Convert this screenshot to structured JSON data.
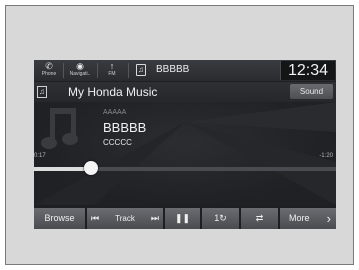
{
  "statusbar": {
    "phone": {
      "icon": "phone-icon",
      "label": "Phone"
    },
    "navigation": {
      "icon": "navigation-icon",
      "label": "Navigati.."
    },
    "fm": {
      "icon": "radio-icon",
      "label": "FM"
    },
    "source_icon": "music-note-icon",
    "source_name": "BBBBB",
    "clock": "12:34"
  },
  "header": {
    "icon": "music-note-icon",
    "title": "My Honda Music",
    "sound_label": "Sound"
  },
  "now_playing": {
    "album": "AAAAA",
    "track": "BBBBB",
    "artist": "CCCCC",
    "elapsed": "0:17",
    "remaining": "-1:20",
    "progress_fraction": 0.19
  },
  "controls": {
    "browse_label": "Browse",
    "track_label": "Track",
    "prev_glyph": "⏮",
    "next_glyph": "⏭",
    "pause_glyph": "❚❚",
    "repeat_glyph": "1↻",
    "shuffle_glyph": "⇄",
    "more_label": "More",
    "more_chevron": "›"
  },
  "colors": {
    "screen_bg": "#1e1f22",
    "button_top": "#6b6c71",
    "button_bottom": "#4a4b50",
    "text": "#f0f0f0"
  }
}
